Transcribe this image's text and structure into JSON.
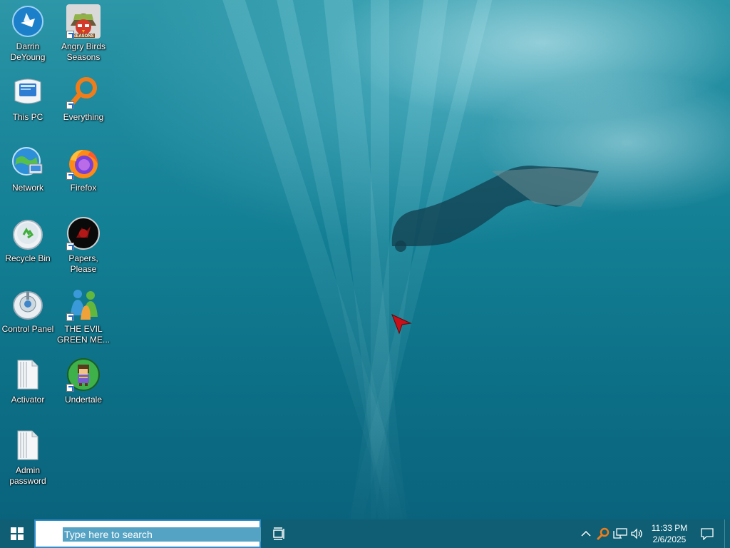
{
  "desktop": {
    "icons": [
      {
        "label": "Darrin\nDeYoung"
      },
      {
        "label": "Angry Birds\nSeasons",
        "badge": "SEASONS"
      },
      {
        "label": "This PC"
      },
      {
        "label": "Everything"
      },
      {
        "label": "Network"
      },
      {
        "label": "Firefox"
      },
      {
        "label": "Recycle Bin"
      },
      {
        "label": "Papers, Please"
      },
      {
        "label": "Control Panel"
      },
      {
        "label": "THE EVIL\nGREEN ME..."
      },
      {
        "label": "Activator"
      },
      {
        "label": "Undertale"
      },
      {
        "label": "Admin\npassword"
      }
    ]
  },
  "taskbar": {
    "search_placeholder": "Type here to search",
    "clock_time": "11:33 PM",
    "clock_date": "2/6/2025"
  },
  "colors": {
    "taskbar": "#0f5e73",
    "accent": "#2f8dc9",
    "wallpaper_top": "#2d97a8",
    "wallpaper_bottom": "#0a637c"
  }
}
